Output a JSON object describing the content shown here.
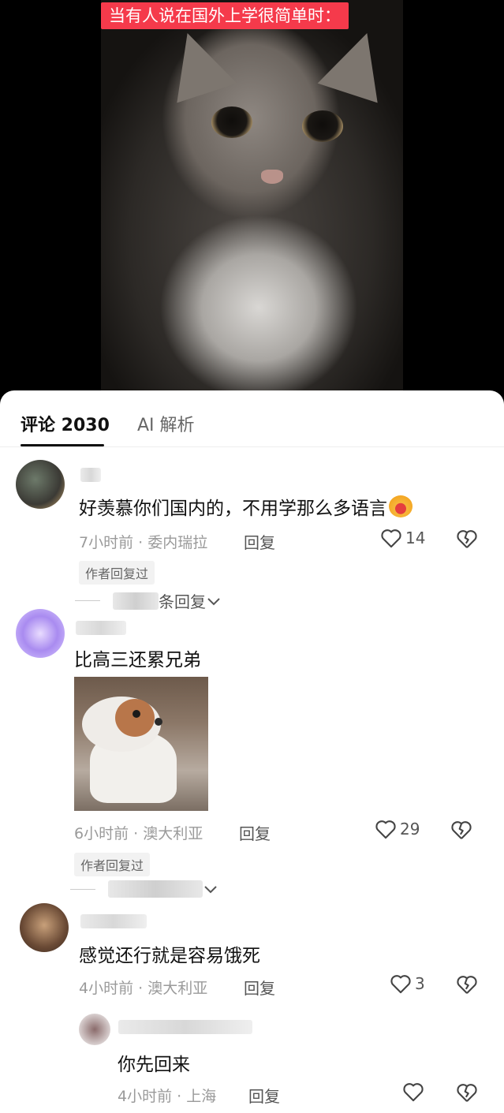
{
  "video": {
    "caption": "当有人说在国外上学很简单时："
  },
  "tabs": {
    "comments_label": "评论 2030",
    "ai_label": "AI 解析"
  },
  "comments": [
    {
      "text": "好羡慕你们国内的，不用学那么多语言",
      "time_location": "7小时前 · 委内瑞拉",
      "reply_label": "回复",
      "likes": "14",
      "author_replied": "作者回复过",
      "expand_label": "条回复"
    },
    {
      "text": "比高三还累兄弟",
      "time_location": "6小时前 · 澳大利亚",
      "reply_label": "回复",
      "likes": "29",
      "author_replied": "作者回复过"
    },
    {
      "text": "感觉还行就是容易饿死",
      "time_location": "4小时前 · 澳大利亚",
      "reply_label": "回复",
      "likes": "3"
    },
    {
      "text": "你先回来",
      "time_location": "4小时前 · 上海",
      "reply_label": "回复",
      "likes": ""
    }
  ],
  "icons": {
    "like": "heart-outline-icon",
    "dislike": "broken-heart-icon",
    "expand": "chevron-down-icon"
  },
  "colors": {
    "caption_bg": "#f53a4b",
    "active_tab": "#111111",
    "meta_text": "#9a9a9a"
  }
}
